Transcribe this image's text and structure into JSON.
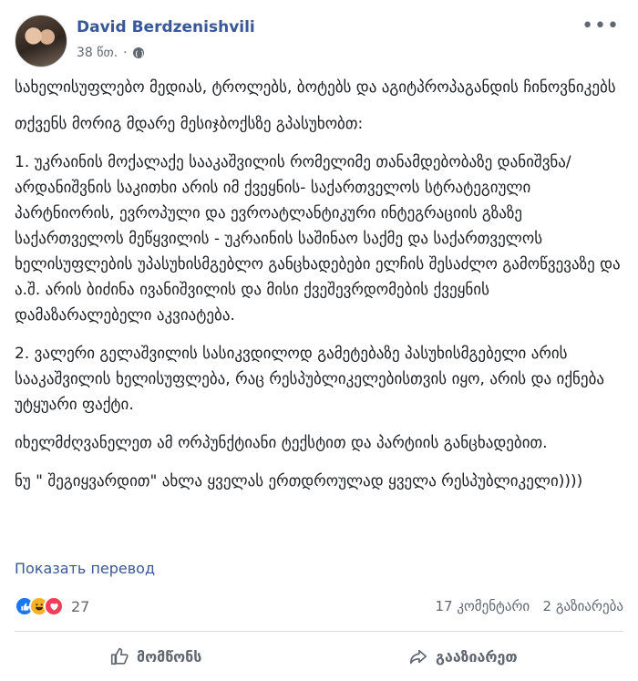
{
  "post": {
    "author": "David Berdzenishvili",
    "time": "38 წთ.",
    "paragraphs": [
      "სახელისუფლებო მედიას, ტროლებს, ბოტებს და აგიტპროპაგანდის ჩინოვნიკებს",
      "თქვენს მორიგ მდარე მესიჯბოქსზე გპასუხობთ:",
      "1. უკრაინის მოქალაქე სააკაშვილის რომელიმე თანამდებობაზე დანიშვნა/არდანიშვნის საკითხი არის იმ ქვეყნის- საქართველოს სტრატეგიული პარტნიორის, ევროპული და ევროატლანტიკური ინტეგრაციის გზაზე საქართველოს მეწყვილის - უკრაინის საშინაო საქმე და საქართველოს ხელისუფლების უპასუხისმგებლო განცხადებები ელჩის შესაძლო გამოწვევაზე და ა.შ. არის ბიძინა ივანიშვილის და მისი ქვეშევრდომების ქვეყნის დამაზარალებელი აკვიატება.",
      "2. ვალერი გელაშვილის სასიკვდილოდ გამეტებაზე პასუხისმგებელი არის სააკაშვილის ხელისუფლება, რაც რესპუბლიკელებისთვის იყო, არის და იქნება უტყუარი ფაქტი.",
      "იხელმძღვანელეთ ამ ორპუნქტიანი ტექსტით და პარტიის განცხადებით.",
      "ნუ \" შეგიყვარდით\" ახლა ყველას ერთდროულად ყველა რესპუბლიკელი))))"
    ],
    "translate_label": "Показать перевод"
  },
  "reactions": {
    "icons": [
      "like-reaction",
      "haha-reaction",
      "love-reaction"
    ],
    "count": "27",
    "comments_label": "17 კომენტარი",
    "shares_label": "2 გაზიარება"
  },
  "actions": {
    "like_label": "მომწონს",
    "share_label": "გააზიარეთ"
  },
  "colors": {
    "link": "#385898",
    "secondary": "#606770",
    "like": "#1877f2",
    "haha": "#f7b125",
    "love": "#f33e58"
  }
}
